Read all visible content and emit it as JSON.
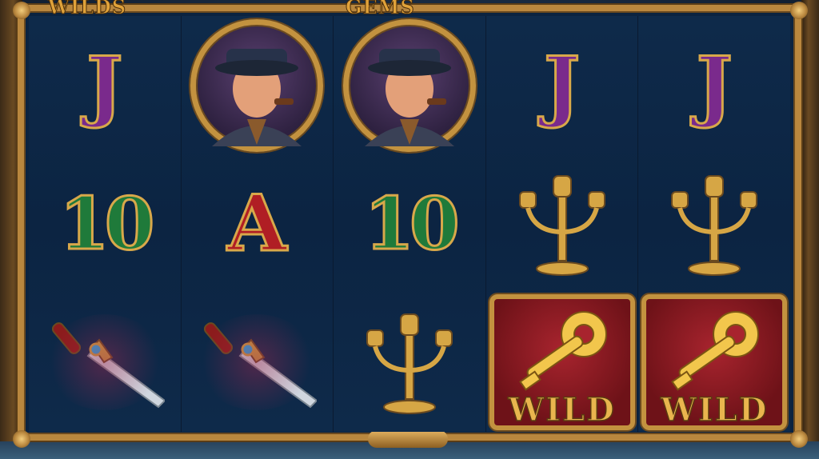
{
  "colors": {
    "frame_gold": "#b9873e",
    "reel_bg": "#0e2a4a",
    "wild_red": "#a8242e"
  },
  "top_labels": {
    "left": "WILDS",
    "center": "GEMS"
  },
  "reels": [
    {
      "symbols": [
        {
          "type": "letter",
          "text": "J",
          "icon": "letter-j-icon"
        },
        {
          "type": "letter",
          "text": "10",
          "icon": "ten-icon"
        },
        {
          "type": "dagger",
          "icon": "dagger-icon"
        }
      ]
    },
    {
      "symbols": [
        {
          "type": "portrait",
          "icon": "detective-portrait-icon"
        },
        {
          "type": "letter",
          "text": "A",
          "icon": "letter-a-icon"
        },
        {
          "type": "dagger",
          "icon": "dagger-icon"
        }
      ]
    },
    {
      "symbols": [
        {
          "type": "portrait",
          "icon": "detective-portrait-icon"
        },
        {
          "type": "letter",
          "text": "10",
          "icon": "ten-icon"
        },
        {
          "type": "candelabra",
          "icon": "candelabra-icon"
        }
      ]
    },
    {
      "symbols": [
        {
          "type": "letter",
          "text": "J",
          "icon": "letter-j-icon"
        },
        {
          "type": "candelabra",
          "icon": "candelabra-icon"
        },
        {
          "type": "wild",
          "text": "WILD",
          "icon": "key-wild-icon"
        }
      ]
    },
    {
      "symbols": [
        {
          "type": "letter",
          "text": "J",
          "icon": "letter-j-icon"
        },
        {
          "type": "candelabra",
          "icon": "candelabra-icon"
        },
        {
          "type": "wild",
          "text": "WILD",
          "icon": "key-wild-icon"
        }
      ]
    }
  ]
}
